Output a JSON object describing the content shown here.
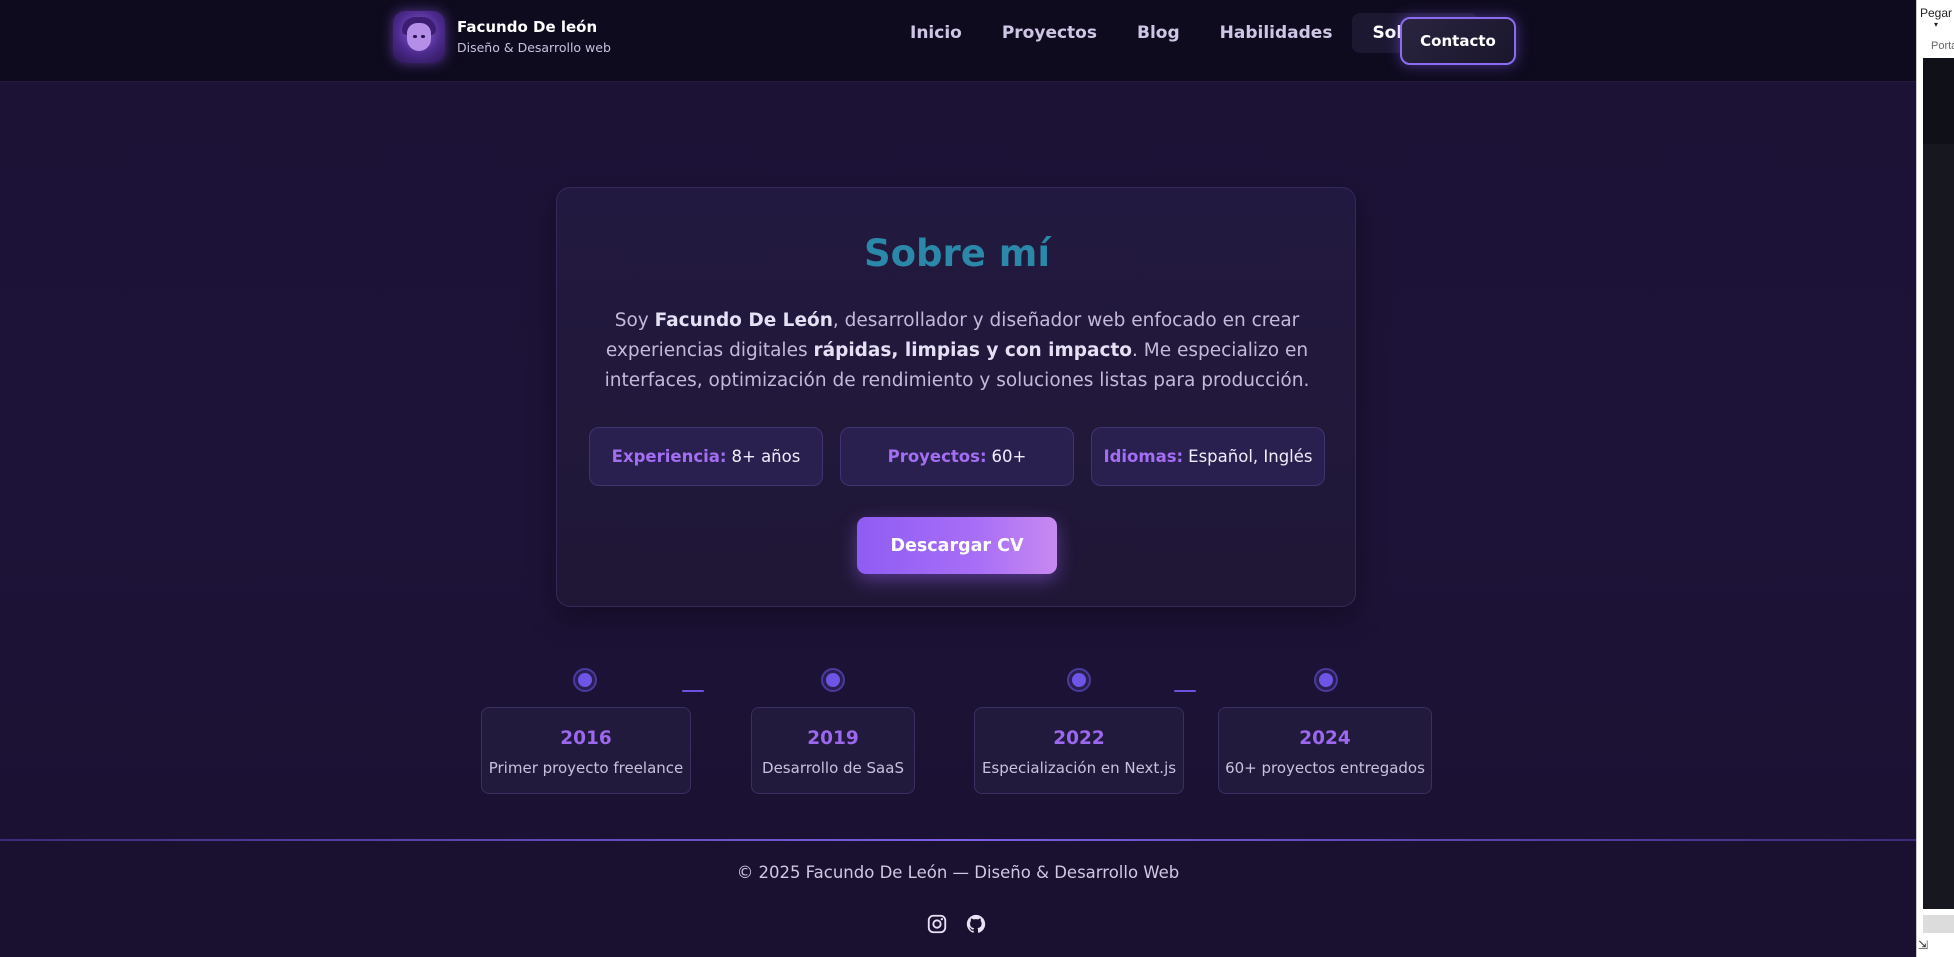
{
  "header": {
    "brand_name": "Facundo De león",
    "brand_subtitle": "Diseño & Desarrollo web",
    "nav": [
      {
        "label": "Inicio"
      },
      {
        "label": "Proyectos"
      },
      {
        "label": "Blog"
      },
      {
        "label": "Habilidades"
      },
      {
        "label": "Sobre mí",
        "active": true
      }
    ],
    "contact_label": "Contacto"
  },
  "about": {
    "title": "Sobre mí",
    "desc_pre": "Soy ",
    "desc_name": "Facundo De León",
    "desc_mid": ", desarrollador y diseñador web enfocado en crear experiencias digitales ",
    "desc_emph": "rápidas, limpias y con impacto",
    "desc_post": ". Me especializo en interfaces, optimización de rendimiento y soluciones listas para producción.",
    "stats": [
      {
        "key": "Experiencia:",
        "value": "8+ años"
      },
      {
        "key": "Proyectos:",
        "value": "60+"
      },
      {
        "key": "Idiomas:",
        "value": "Español, Inglés"
      }
    ],
    "cv_label": "Descargar CV"
  },
  "timeline": [
    {
      "year": "2016",
      "text": "Primer proyecto freelance"
    },
    {
      "year": "2019",
      "text": "Desarrollo de SaaS"
    },
    {
      "year": "2022",
      "text": "Especialización en Next.js"
    },
    {
      "year": "2024",
      "text": "60+ proyectos entregados"
    }
  ],
  "footer": {
    "copyright": "© 2025 Facundo De León — Diseño & Desarrollo Web",
    "socials": [
      "instagram-icon",
      "github-icon"
    ]
  },
  "side_app": {
    "paste_label": "Pegar",
    "portapapeles_label": "Porta"
  },
  "colors": {
    "accent": "#8f5cf3",
    "title": "#2b88a8",
    "background": "#1c1236",
    "header": "#0f0b1f"
  }
}
